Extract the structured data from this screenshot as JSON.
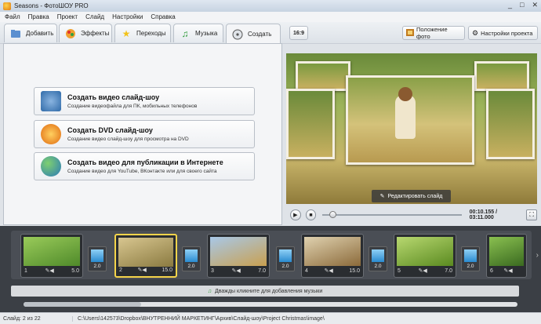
{
  "window": {
    "title": "Seasons - ФотоШОУ PRO",
    "min": "_",
    "max": "□",
    "close": "✕"
  },
  "menu": [
    "Файл",
    "Правка",
    "Проект",
    "Слайд",
    "Настройки",
    "Справка"
  ],
  "tabs": [
    {
      "label": "Добавить",
      "icon": "add-folder-icon"
    },
    {
      "label": "Эффекты",
      "icon": "effects-icon"
    },
    {
      "label": "Переходы",
      "icon": "star-icon"
    },
    {
      "label": "Музыка",
      "icon": "music-note-icon"
    },
    {
      "label": "Создать",
      "icon": "disc-icon"
    }
  ],
  "toolbar_right": {
    "ratio": "16:9",
    "photo_position": "Положение фото",
    "project_settings": "Настройки проекта"
  },
  "create_options": [
    {
      "title": "Создать видео слайд-шоу",
      "desc": "Создание видеофайла для ПК, мобильных телефонов",
      "icon": "video-devices-icon"
    },
    {
      "title": "Создать DVD слайд-шоу",
      "desc": "Создание видео слайд-шоу для просмотра на DVD",
      "icon": "dvd-disc-icon"
    },
    {
      "title": "Создать видео для публикации в Интернете",
      "desc": "Создание видео для YouTube, ВКонтакте или для своего сайта",
      "icon": "globe-icon"
    }
  ],
  "preview": {
    "edit_slide": "Редактировать слайд"
  },
  "player": {
    "time": "00:10.155 / 03:11.000",
    "progress": 0.05
  },
  "slides": [
    {
      "num": "1",
      "duration": "5.0",
      "colors": [
        "#9acb5a",
        "#4f8a2a"
      ]
    },
    {
      "num": "2",
      "duration": "15.0",
      "colors": [
        "#d8c690",
        "#8a7a40"
      ]
    },
    {
      "num": "3",
      "duration": "7.0",
      "colors": [
        "#a8c8e8",
        "#c9a050"
      ]
    },
    {
      "num": "4",
      "duration": "15.0",
      "colors": [
        "#e0d2b0",
        "#8b6a3a"
      ]
    },
    {
      "num": "5",
      "duration": "7.0",
      "colors": [
        "#b8d870",
        "#5a8a20"
      ]
    },
    {
      "num": "6",
      "duration": "",
      "colors": [
        "#8ac050",
        "#3a6a20"
      ]
    }
  ],
  "transitions": [
    "2.0",
    "2.0",
    "2.0",
    "2.0",
    "2.0"
  ],
  "music_hint": "Дважды кликните для добавления музыки",
  "status": {
    "slide": "Слайд: 2 из 22",
    "path": "C:\\Users\\142573\\Dropbox\\ВНУТРЕННИЙ МАРКЕТИНГ\\Архив\\Слайд-шоу\\Project Christmas\\image\\"
  }
}
